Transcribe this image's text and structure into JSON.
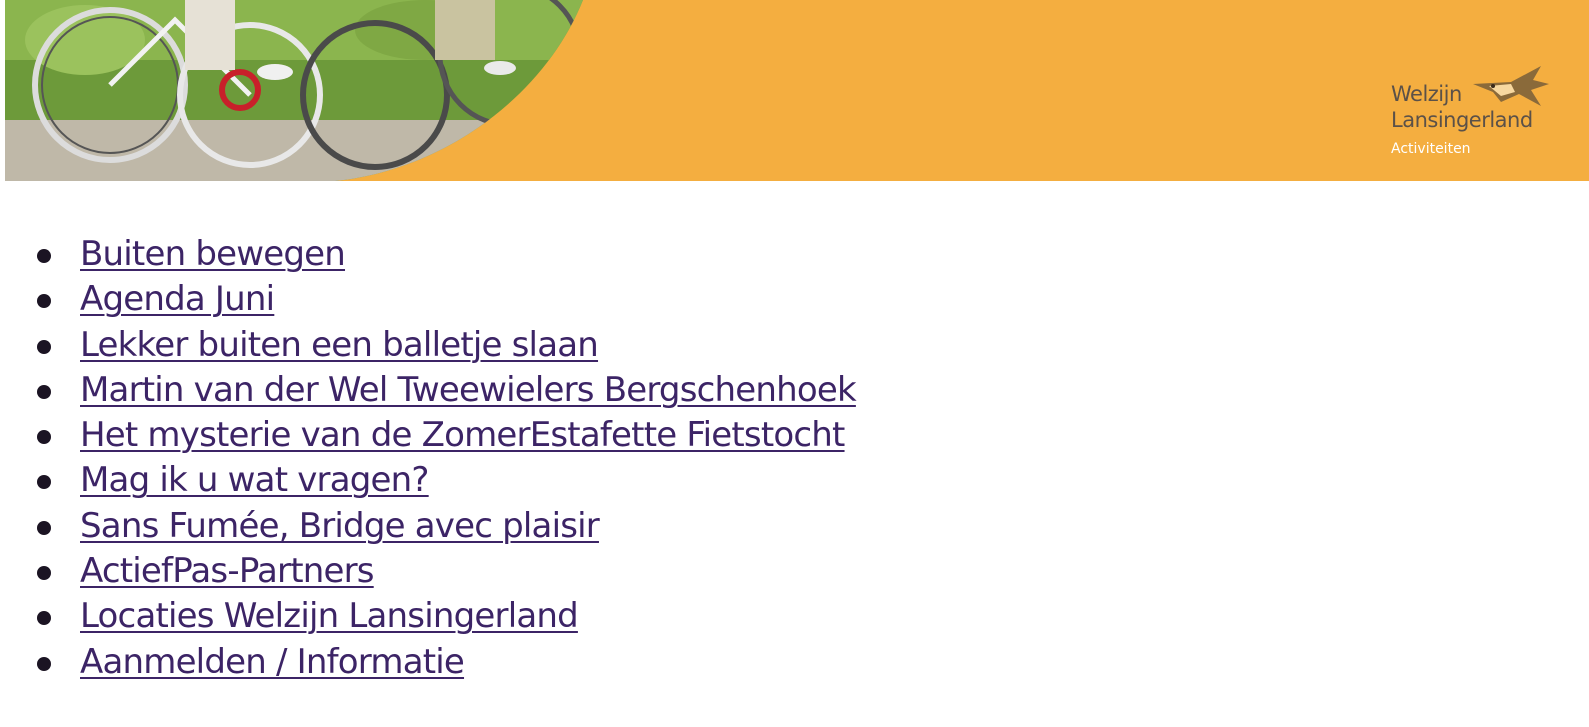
{
  "banner": {
    "background_color": "#f4ae40",
    "image_alt": "bicycles-photo",
    "logo": {
      "line1": "Welzijn",
      "line2": "Lansingerland",
      "line3": "Activiteiten",
      "icon": "bird-icon"
    }
  },
  "nav": {
    "bullet_color": "#1b1423",
    "link_color": "#3c2466",
    "items": [
      {
        "label": "Buiten bewegen"
      },
      {
        "label": "Agenda Juni"
      },
      {
        "label": "Lekker buiten een balletje slaan"
      },
      {
        "label": "Martin van der Wel Tweewielers Bergschenhoek"
      },
      {
        "label": "Het mysterie van de ZomerEstafette Fietstocht"
      },
      {
        "label": "Mag ik u wat vragen?"
      },
      {
        "label": "Sans Fumée, Bridge avec plaisir"
      },
      {
        "label": "ActiefPas-Partners"
      },
      {
        "label": "Locaties Welzijn Lansingerland"
      },
      {
        "label": "Aanmelden / Informatie"
      }
    ]
  }
}
